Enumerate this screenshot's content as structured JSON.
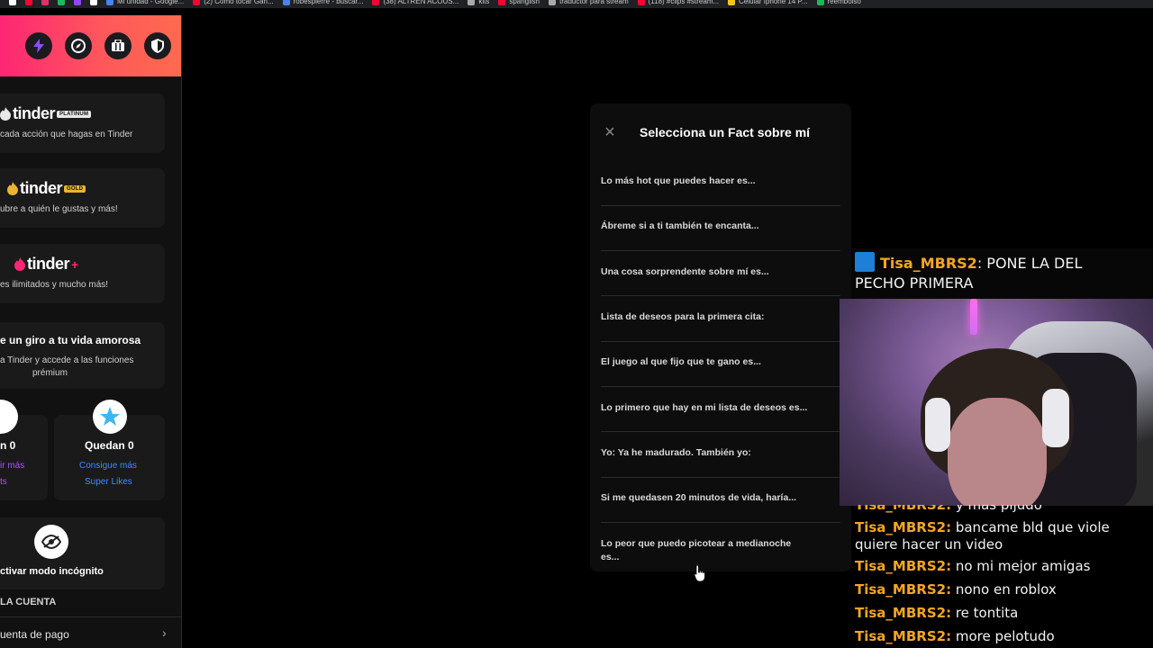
{
  "bookmarks": [
    {
      "label": "",
      "color": "#ffffff"
    },
    {
      "label": "",
      "color": "#ff0033"
    },
    {
      "label": "",
      "color": "#e1306c"
    },
    {
      "label": "",
      "color": "#1db954"
    },
    {
      "label": "",
      "color": "#9146ff"
    },
    {
      "label": "",
      "color": "#ffffff"
    },
    {
      "label": "Mi unidad - Google...",
      "color": "#4285f4"
    },
    {
      "label": "(2) Cómo tocar Gan...",
      "color": "#ff0033"
    },
    {
      "label": "robespierre - buscar...",
      "color": "#4285f4"
    },
    {
      "label": "(38) ALTREN ACOUS...",
      "color": "#ff0033"
    },
    {
      "label": "kits",
      "color": "#aaaaaa"
    },
    {
      "label": "spanglish",
      "color": "#ff0033"
    },
    {
      "label": "traductor para stream",
      "color": "#aaaaaa"
    },
    {
      "label": "(118) #clips #stream...",
      "color": "#ff0033"
    },
    {
      "label": "Celular Iphone 14 P...",
      "color": "#f5c518"
    },
    {
      "label": "reembolso",
      "color": "#1db954"
    }
  ],
  "sidebar": {
    "head_icons": [
      "bolt-icon",
      "compass-icon",
      "briefcase-icon",
      "shield-icon"
    ],
    "platinum": {
      "brand": "tinder",
      "tag": "PLATINUM",
      "desc": "cada acción que hagas en Tinder"
    },
    "gold": {
      "brand": "tinder",
      "tag": "GOLD",
      "desc": "ubre a quién le gustas y más!"
    },
    "plus": {
      "brand": "tinder",
      "tag": "+",
      "desc": "es ilimitados y mucho más!"
    },
    "promo": {
      "title": "e un giro a tu vida amorosa",
      "desc_line1": "a Tinder y accede a las funciones",
      "desc_line2": "prémium"
    },
    "boosts": {
      "count_label": "n 0",
      "link1": "ir más",
      "link2": "ts"
    },
    "superlikes": {
      "count_label": "Quedan 0",
      "link1": "Consigue más",
      "link2": "Super Likes"
    },
    "incognito": {
      "label": "ctivar modo incógnito"
    },
    "section_title": "LA CUENTA",
    "account_item": "uenta de pago"
  },
  "modal": {
    "title": "Selecciona un Fact sobre mí",
    "options": [
      "Lo más hot que puedes hacer es...",
      "Ábreme si a ti también te encanta...",
      "Una cosa sorprendente sobre mí es...",
      "Lista de deseos para la primera cita:",
      "El juego al que fijo que te gano es...",
      "Lo primero que hay en mi lista de deseos es...",
      "Yo: Ya he madurado. También yo:",
      "Si me quedasen 20 minutos de vida, haría...",
      "Lo peor que puedo picotear a medianoche",
      "es..."
    ]
  },
  "chat": {
    "top": {
      "name": "Tisa_MBRS2",
      "sep": ":",
      "msg_line1": " PONE LA DEL",
      "msg_line2": "PECHO PRIMERA"
    },
    "partial": {
      "name": "Tisa_MBRS2:",
      "msg": " y más pijudo"
    },
    "messages": [
      {
        "name": "Tisa_MBRS2:",
        "msg": " bancame bld que viole",
        "msg2": "quiere hacer un video"
      },
      {
        "name": "Tisa_MBRS2:",
        "msg": " no mi mejor amigas"
      },
      {
        "name": "Tisa_MBRS2:",
        "msg": " nono en roblox"
      },
      {
        "name": "Tisa_MBRS2:",
        "msg": " re tontita"
      },
      {
        "name": "Tisa_MBRS2:",
        "msg": " more pelotudo"
      }
    ]
  }
}
